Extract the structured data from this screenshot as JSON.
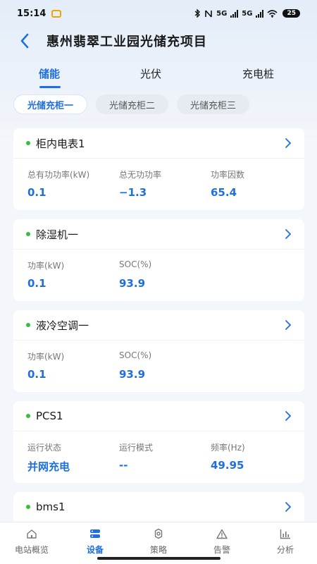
{
  "status_bar": {
    "time": "15:14",
    "network_labels": [
      "5G",
      "5G"
    ],
    "battery": "25"
  },
  "header": {
    "title": "惠州翡翠工业园光储充项目"
  },
  "main_tabs": [
    {
      "label": "储能",
      "active": true
    },
    {
      "label": "光伏",
      "active": false
    },
    {
      "label": "充电桩",
      "active": false
    }
  ],
  "sub_tabs": [
    {
      "label": "光储充柜一",
      "active": true
    },
    {
      "label": "光储充柜二",
      "active": false
    },
    {
      "label": "光储充柜三",
      "active": false
    }
  ],
  "devices": [
    {
      "title": "柜内电表1",
      "status_color": "#35c03c",
      "metrics": [
        {
          "label": "总有功功率(kW)",
          "value": "0.1"
        },
        {
          "label": "总无功功率",
          "value": "−1.3"
        },
        {
          "label": "功率因数",
          "value": "65.4"
        }
      ]
    },
    {
      "title": "除湿机一",
      "status_color": "#35c03c",
      "metrics": [
        {
          "label": "功率(kW)",
          "value": "0.1"
        },
        {
          "label": "SOC(%)",
          "value": "93.9"
        }
      ]
    },
    {
      "title": "液冷空调一",
      "status_color": "#35c03c",
      "metrics": [
        {
          "label": "功率(kW)",
          "value": "0.1"
        },
        {
          "label": "SOC(%)",
          "value": "93.9"
        }
      ]
    },
    {
      "title": "PCS1",
      "status_color": "#35c03c",
      "metrics": [
        {
          "label": "运行状态",
          "value": "并网充电"
        },
        {
          "label": "运行模式",
          "value": "--"
        },
        {
          "label": "频率(Hz)",
          "value": "49.95"
        }
      ]
    },
    {
      "title": "bms1",
      "status_color": "#35c03c",
      "metrics": []
    }
  ],
  "bottom_nav": [
    {
      "label": "电站概览",
      "icon": "home-icon",
      "active": false
    },
    {
      "label": "设备",
      "icon": "device-icon",
      "active": true
    },
    {
      "label": "策略",
      "icon": "strategy-gear-icon",
      "active": false
    },
    {
      "label": "告警",
      "icon": "alert-icon",
      "active": false
    },
    {
      "label": "分析",
      "icon": "analysis-chart-icon",
      "active": false
    }
  ],
  "colors": {
    "accent": "#1f6fe0",
    "online_dot": "#35c03c"
  }
}
